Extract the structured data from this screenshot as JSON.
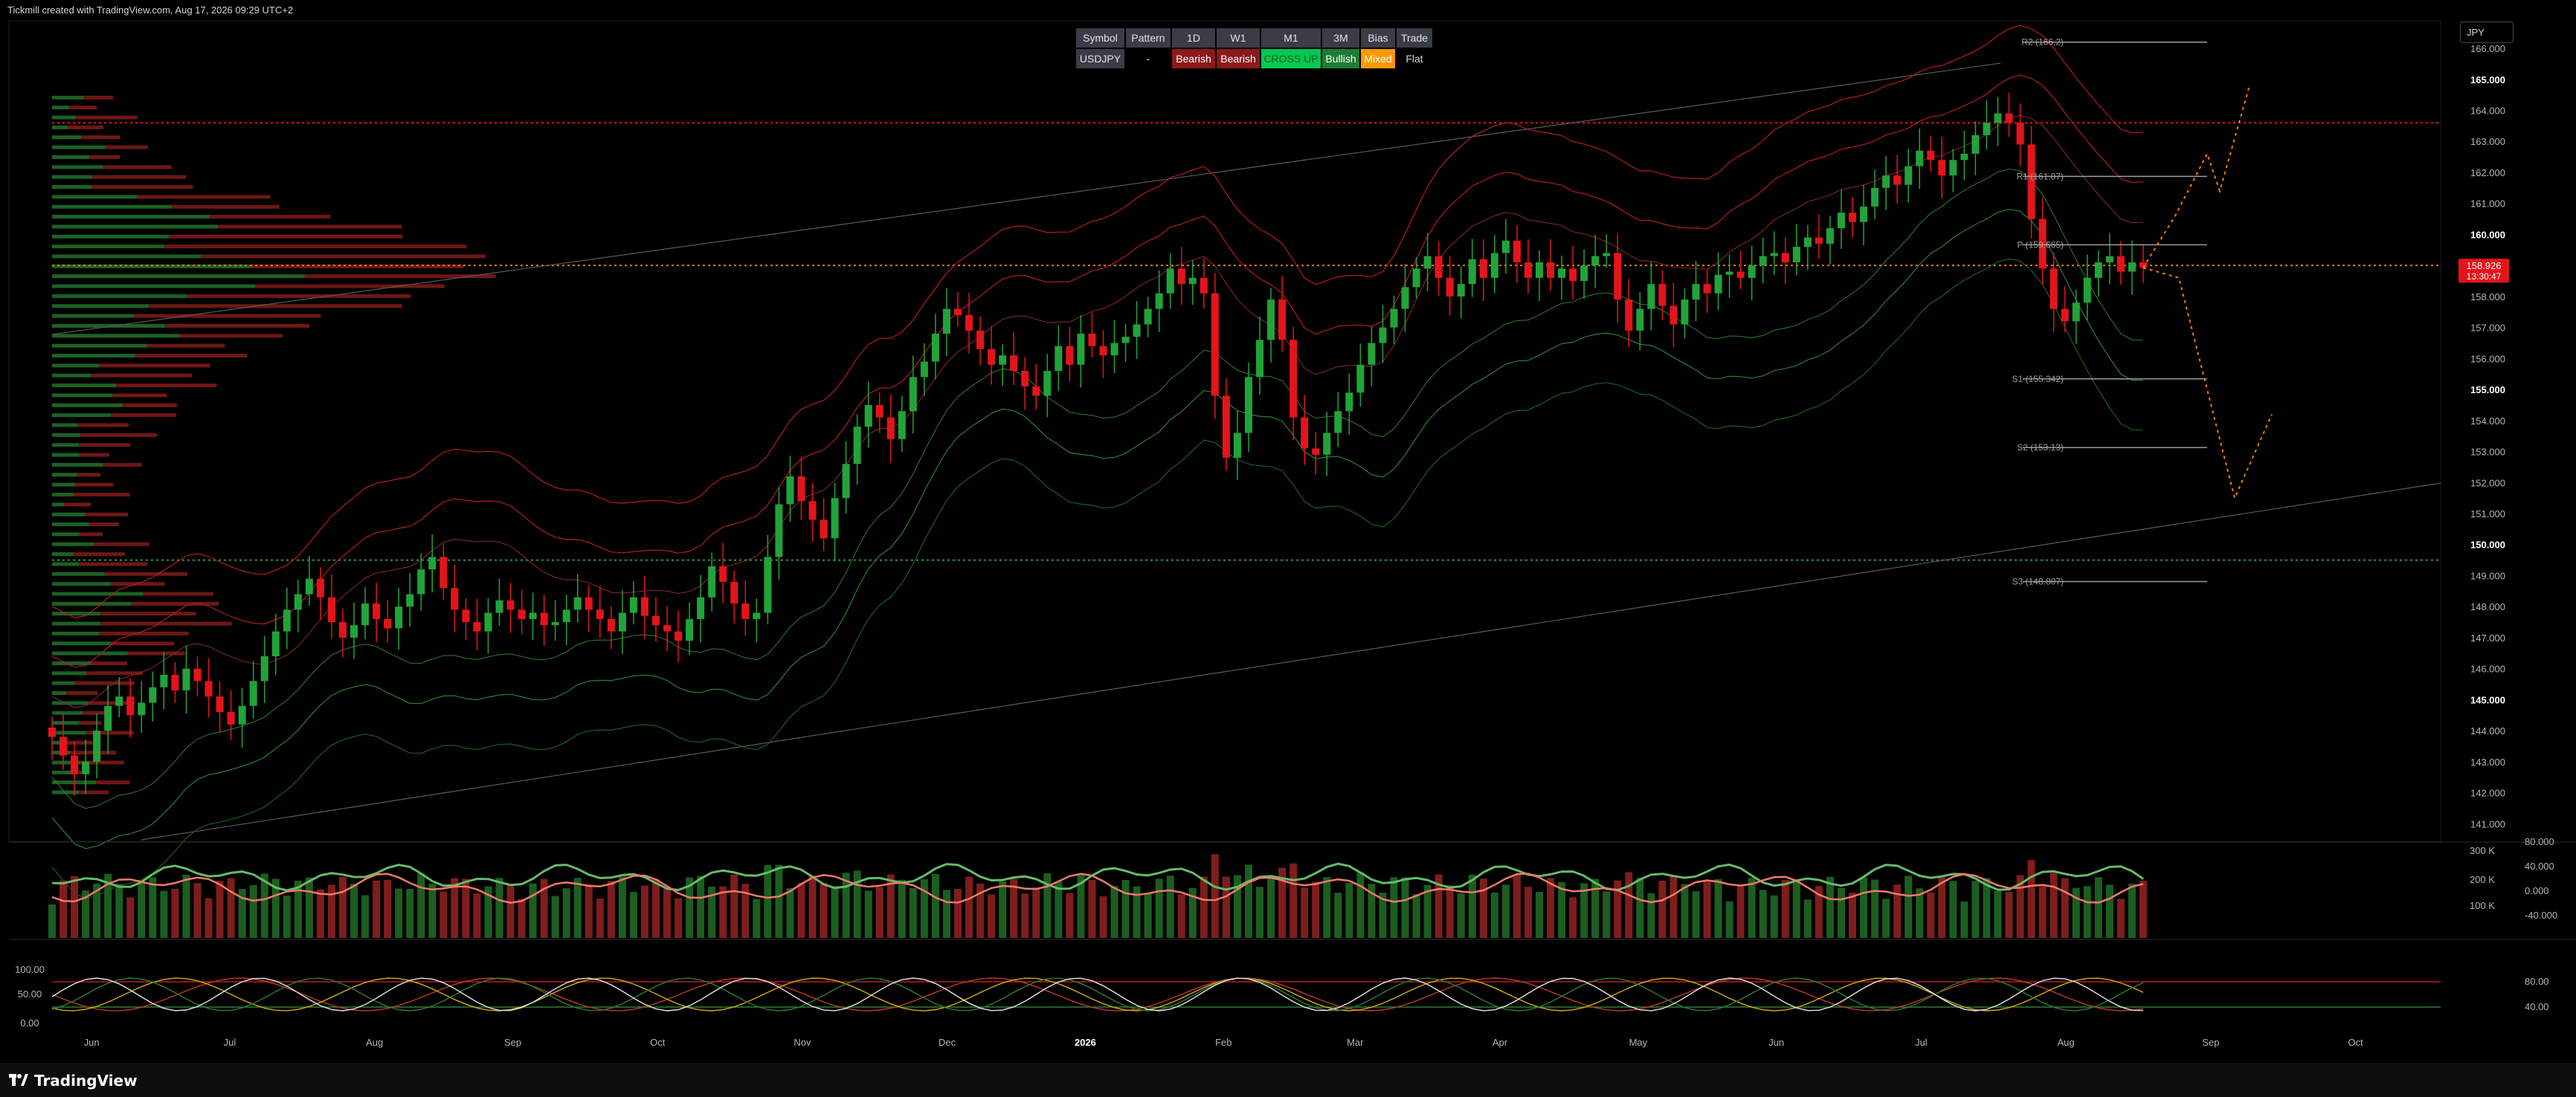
{
  "header": {
    "attribution": "Tickmill created with TradingView.com, Aug 17, 2026 09:29 UTC+2"
  },
  "currency_button": "JPY",
  "footer": {
    "brand": "TradingView"
  },
  "colors": {
    "bull": "#22a33a",
    "bear": "#e5141b",
    "accent": "#f57c00",
    "price_label_bg": "#e5141b",
    "bullish_cell": "#089981",
    "mixed_cell": "#ff9800",
    "cross_cell": "#00e676"
  },
  "info_table": {
    "headers": [
      "Symbol",
      "Pattern",
      "1D",
      "W1",
      "M1",
      "3M",
      "Bias",
      "Trade"
    ],
    "values": [
      "USDJPY",
      "-",
      "Bearish",
      "Bearish",
      "CROSS UP",
      "Bullish",
      "Mixed",
      "Flat"
    ],
    "value_colors": [
      "#3a3d46",
      "#000000",
      "#8b1a1a",
      "#8b1a1a",
      "#00c853",
      "#1e7b34",
      "#ff9800",
      "#000000"
    ],
    "value_text_colors": [
      "#e0e3eb",
      "#d1d4dc",
      "#ffffff",
      "#ffffff",
      "#1b5e20",
      "#ffffff",
      "#ffffff",
      "#d1d4dc"
    ]
  },
  "chart_data": [
    {
      "type": "candlestick",
      "symbol": "USDJPY",
      "ylim": [
        140.6,
        166.6
      ],
      "y_ticks": [
        "141.000",
        "142.000",
        "143.000",
        "144.000",
        "145.000",
        "146.000",
        "147.000",
        "148.000",
        "149.000",
        "150.000",
        "151.000",
        "152.000",
        "153.000",
        "154.000",
        "155.000",
        "156.000",
        "157.000",
        "158.000",
        "159.000",
        "160.000",
        "161.000",
        "162.000",
        "163.000",
        "164.000",
        "165.000",
        "166.000"
      ],
      "y_major": [
        "145.000",
        "150.000",
        "155.000",
        "160.000",
        "165.000"
      ],
      "x_labels": [
        "Jun",
        "Jul",
        "Aug",
        "Sep",
        "Oct",
        "Nov",
        "Dec",
        "2026",
        "Feb",
        "Mar",
        "Apr",
        "May",
        "Jun",
        "Jul",
        "Aug",
        "Sep",
        "Oct"
      ],
      "x_label_index": [
        6,
        27,
        49,
        70,
        92,
        114,
        136,
        157,
        178,
        198,
        220,
        241,
        262,
        284,
        306,
        328,
        350
      ],
      "last_price": "158.926",
      "countdown": "13:30:47",
      "close_series": [
        143.8,
        143.2,
        142.6,
        143.0,
        144.0,
        144.8,
        145.1,
        144.5,
        144.9,
        145.4,
        145.8,
        145.3,
        146.0,
        145.6,
        145.1,
        144.6,
        144.2,
        144.8,
        145.6,
        146.4,
        147.2,
        147.9,
        148.4,
        148.9,
        148.3,
        147.5,
        147.0,
        147.4,
        148.1,
        147.6,
        147.3,
        148.0,
        148.4,
        149.2,
        149.6,
        148.6,
        147.9,
        147.5,
        147.2,
        147.8,
        148.2,
        147.9,
        147.6,
        147.8,
        147.4,
        147.5,
        147.9,
        148.3,
        147.9,
        147.6,
        147.2,
        147.8,
        148.3,
        147.7,
        147.4,
        147.2,
        146.9,
        147.6,
        148.3,
        149.3,
        148.8,
        148.1,
        147.6,
        147.8,
        149.6,
        151.3,
        152.2,
        151.4,
        150.8,
        150.2,
        151.5,
        152.6,
        153.8,
        154.5,
        154.1,
        153.4,
        154.3,
        155.4,
        155.9,
        156.8,
        157.6,
        157.4,
        156.9,
        156.3,
        155.8,
        156.1,
        155.6,
        155.1,
        154.8,
        155.6,
        156.4,
        155.8,
        156.8,
        156.4,
        156.1,
        156.5,
        156.7,
        157.1,
        157.6,
        158.1,
        158.9,
        158.4,
        158.6,
        158.1,
        154.8,
        152.8,
        153.6,
        155.4,
        156.6,
        157.9,
        156.6,
        154.1,
        153.1,
        152.9,
        153.6,
        154.3,
        154.9,
        155.8,
        156.5,
        157.0,
        157.6,
        158.3,
        158.9,
        159.3,
        158.6,
        158.0,
        158.4,
        159.2,
        158.6,
        159.4,
        159.8,
        159.1,
        158.6,
        159.1,
        158.6,
        158.9,
        158.5,
        159.0,
        159.3,
        159.4,
        157.9,
        156.9,
        157.6,
        158.4,
        157.7,
        157.1,
        157.9,
        158.4,
        158.1,
        158.7,
        158.8,
        158.6,
        159.0,
        159.3,
        159.4,
        159.1,
        159.6,
        159.9,
        159.7,
        160.2,
        160.7,
        160.4,
        160.9,
        161.5,
        161.9,
        161.6,
        162.2,
        162.7,
        162.4,
        161.9,
        162.4,
        162.6,
        163.2,
        163.6,
        163.9,
        163.6,
        162.9,
        160.5,
        158.9,
        157.6,
        157.2,
        157.8,
        158.6,
        159.1,
        159.3,
        158.8,
        159.1,
        158.926
      ],
      "volume_profile_note": "horizontal volume-at-price histogram on left",
      "pivot_levels": [
        {
          "label": "R2 (166.2)",
          "value": 166.2
        },
        {
          "label": "R1 (161.87)",
          "value": 161.87
        },
        {
          "label": "P (159.665)",
          "value": 159.665
        },
        {
          "label": "S1 (155.342)",
          "value": 155.342
        },
        {
          "label": "S2 (153.13)",
          "value": 153.13
        },
        {
          "label": "S3 (148.807)",
          "value": 148.807
        }
      ],
      "horizontal_lines": [
        {
          "value": 163.6,
          "style": "dotted",
          "color": "#e5141b"
        },
        {
          "value": 159.0,
          "style": "dotted",
          "color": "#f57c00"
        },
        {
          "value": 149.5,
          "style": "dotted",
          "color": "#22a33a"
        }
      ]
    },
    {
      "type": "bar",
      "name": "volume",
      "y_ticks_left": [
        "100 K",
        "200 K",
        "300 K"
      ],
      "y_ticks_right": [
        "80.000",
        "40.000",
        "0.000",
        "-40.000"
      ]
    },
    {
      "type": "line",
      "name": "oscillator",
      "y_ticks_left": [
        "100.00",
        "50.00",
        "0.00"
      ],
      "y_ticks_right": [
        "80.00",
        "40.00"
      ]
    }
  ]
}
